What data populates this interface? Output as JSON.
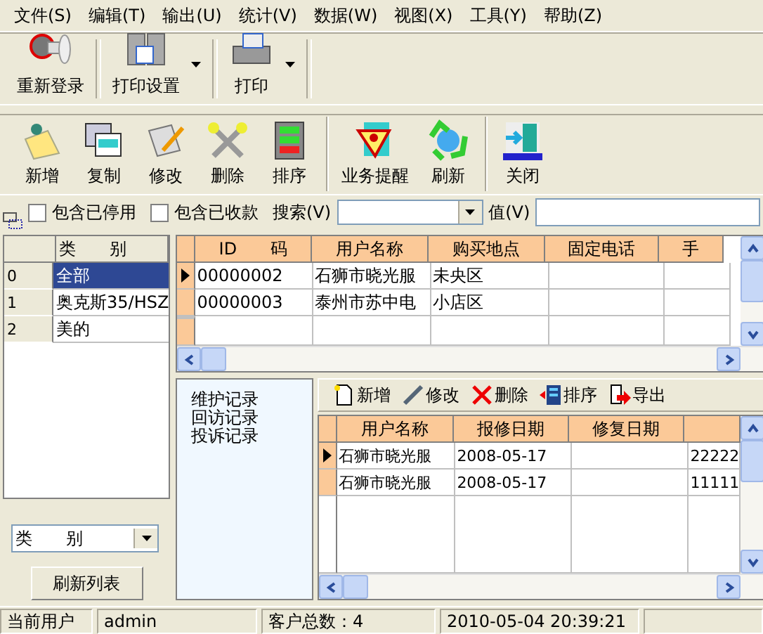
{
  "menu": [
    {
      "label": "文件(S)"
    },
    {
      "label": "编辑(T)"
    },
    {
      "label": "输出(U)"
    },
    {
      "label": "统计(V)"
    },
    {
      "label": "数据(W)"
    },
    {
      "label": "视图(X)"
    },
    {
      "label": "工具(Y)"
    },
    {
      "label": "帮助(Z)"
    }
  ],
  "toolbar_top": [
    {
      "label": "重新登录",
      "dropdown": false
    },
    {
      "label": "打印设置",
      "dropdown": true
    },
    {
      "label": "打印",
      "dropdown": true
    }
  ],
  "toolbar_main": [
    {
      "label": "新增",
      "separator_before": false
    },
    {
      "label": "复制",
      "separator_before": false
    },
    {
      "label": "修改",
      "separator_before": false
    },
    {
      "label": "删除",
      "separator_before": false
    },
    {
      "label": "排序",
      "separator_before": false
    },
    {
      "label": "业务提醒",
      "separator_before": true
    },
    {
      "label": "刷新",
      "separator_before": false
    },
    {
      "label": "关闭",
      "separator_before": true
    }
  ],
  "filters": {
    "checkboxes": [
      {
        "label": "包含已停用",
        "checked": false
      },
      {
        "label": "包含已收款",
        "checked": false
      }
    ],
    "search_label": "搜索(V)",
    "value_label": "值(V)"
  },
  "categories": {
    "header": "类　　别",
    "rows": [
      {
        "index": "0",
        "name": "全部",
        "selected": true
      },
      {
        "index": "1",
        "name": "奥克斯35/HSZ",
        "selected": false
      },
      {
        "index": "2",
        "name": "美的",
        "selected": false
      }
    ]
  },
  "customers": {
    "columns": [
      "ID　　码",
      "用户名称",
      "购买地点",
      "固定电话",
      "手"
    ],
    "rows": [
      {
        "cells": [
          "00000002",
          "石狮市晓光服",
          "未央区",
          "",
          ""
        ],
        "selected": true
      },
      {
        "cells": [
          "00000003",
          "泰州市苏中电",
          "小店区",
          "",
          ""
        ],
        "selected": false
      }
    ]
  },
  "category_select": {
    "value": "类　　别"
  },
  "refresh_button": "刷新列表",
  "record_types": [
    "维护记录",
    "回访记录",
    "投诉记录"
  ],
  "record_toolbar": [
    "新增",
    "修改",
    "删除",
    "排序",
    "导出"
  ],
  "records": {
    "columns": [
      "用户名称",
      "报修日期",
      "修复日期"
    ],
    "rows": [
      {
        "cells": [
          "石狮市晓光服",
          "2008-05-17",
          "",
          "22222"
        ],
        "selected": true
      },
      {
        "cells": [
          "石狮市晓光服",
          "2008-05-17",
          "",
          "11111"
        ],
        "selected": false
      }
    ]
  },
  "status_bar": [
    "当前用户",
    "admin",
    "客户总数：4",
    "2010-05-04 20:39:21"
  ]
}
